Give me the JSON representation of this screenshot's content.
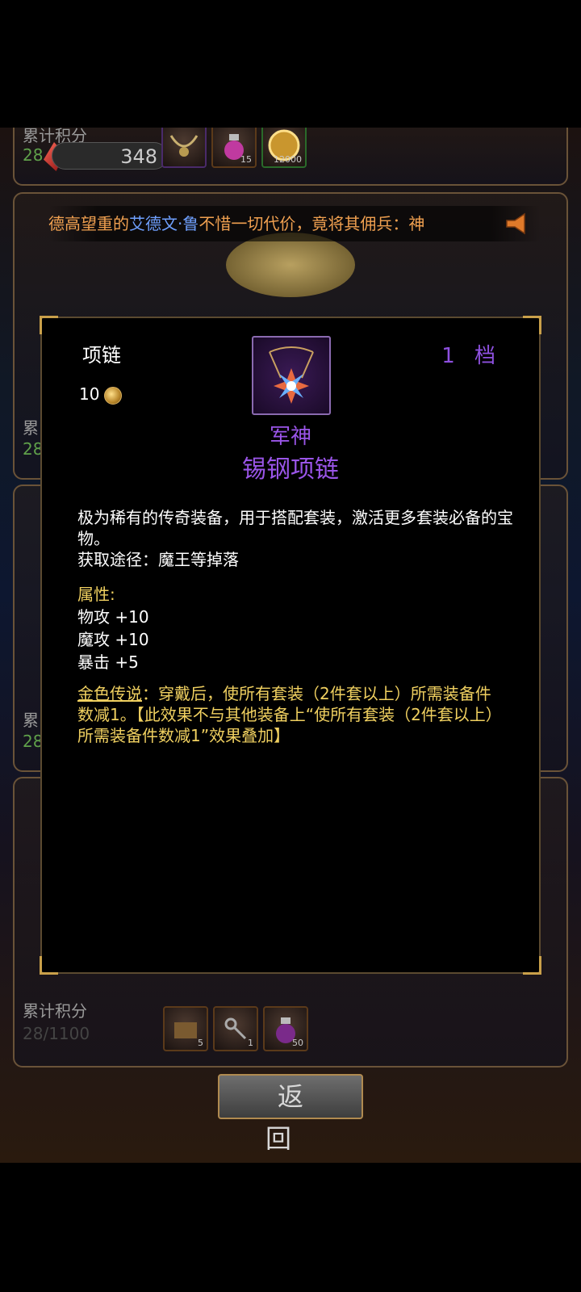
{
  "top_card": {
    "label": "累计积分",
    "count_partial": "28",
    "score": "348",
    "rewards": [
      {
        "icon": "winged-necklace-icon",
        "qty": ""
      },
      {
        "icon": "potion-icon",
        "qty": "15"
      },
      {
        "icon": "gold-coin-icon",
        "qty": "12000"
      }
    ]
  },
  "marquee": {
    "prefix": "德高望重的",
    "name": "艾德文·鲁",
    "suffix": "不惜一切代价，竟将其佣兵：神"
  },
  "middle_cards": [
    {
      "label": "累",
      "count": "28"
    },
    {
      "label": "累",
      "count": "28"
    }
  ],
  "bottom_card": {
    "label": "累计积分",
    "count": "28/1100",
    "rewards": [
      {
        "icon": "chest-icon",
        "qty": "5"
      },
      {
        "icon": "keys-icon",
        "qty": "1"
      },
      {
        "icon": "potion-icon",
        "qty": "50"
      }
    ]
  },
  "modal": {
    "slot": "项链",
    "tier": "1 档",
    "price": "10",
    "prefix": "军神",
    "name": "锡钢项链",
    "description": "极为稀有的传奇装备，用于搭配套装，激活更多套装必备的宝物。",
    "source": "获取途径：魔王等掉落",
    "attr_title": "属性:",
    "attributes": [
      "物攻 +10",
      "魔攻 +10",
      "暴击 +5"
    ],
    "legend_label": "金色传说",
    "legend_text": "：穿戴后，使所有套装（2件套以上）所需装备件数减1。【此效果不与其他装备上“使所有套装（2件套以上）所需装备件数减1”效果叠加】"
  },
  "back_button": "返 回"
}
